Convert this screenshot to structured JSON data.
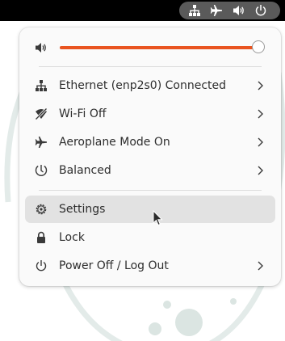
{
  "top_bar": {
    "tray_icons": [
      "network-wired-icon",
      "airplane-mode-icon",
      "volume-icon",
      "power-icon"
    ]
  },
  "quick_settings": {
    "volume": {
      "icon": "speaker-icon",
      "level": 1.0
    },
    "connectivity": [
      {
        "id": "ethernet",
        "icon": "network-wired-icon",
        "label": "Ethernet (enp2s0) Connected",
        "has_submenu": true
      },
      {
        "id": "wifi",
        "icon": "wifi-off-icon",
        "label": "Wi-Fi Off",
        "has_submenu": true
      },
      {
        "id": "aeroplane",
        "icon": "airplane-icon",
        "label": "Aeroplane Mode On",
        "has_submenu": true
      },
      {
        "id": "power-mode",
        "icon": "power-profile-icon",
        "label": "Balanced",
        "has_submenu": true
      }
    ],
    "system": [
      {
        "id": "settings",
        "icon": "gear-icon",
        "label": "Settings",
        "has_submenu": false,
        "hovered": true
      },
      {
        "id": "lock",
        "icon": "lock-icon",
        "label": "Lock",
        "has_submenu": false
      },
      {
        "id": "power-off",
        "icon": "power-icon",
        "label": "Power Off / Log Out",
        "has_submenu": true
      }
    ]
  },
  "colors": {
    "accent": "#e95420",
    "topbar": "#000000",
    "menu_bg": "#fafafa",
    "hover_bg": "#e2e2e2",
    "text": "#2e2e2e"
  }
}
